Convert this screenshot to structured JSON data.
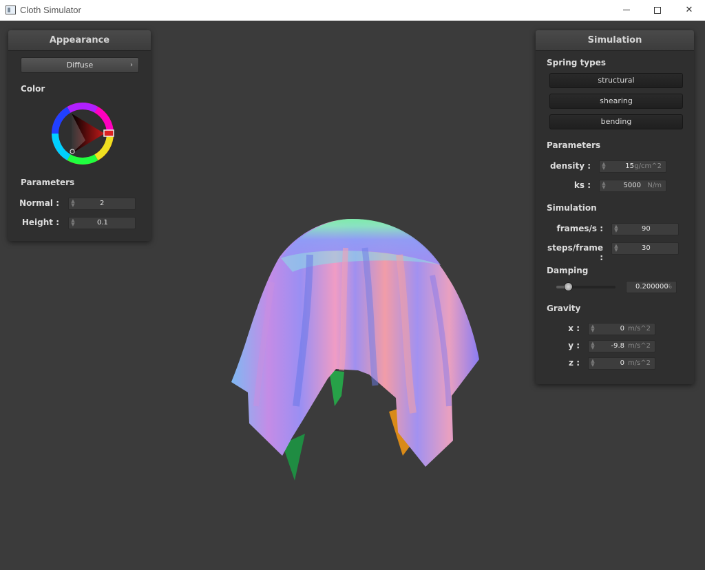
{
  "window": {
    "title": "Cloth Simulator",
    "controls": {
      "minimize": "minimize",
      "maximize": "maximize",
      "close": "✕"
    }
  },
  "appearance": {
    "title": "Appearance",
    "shader_dropdown": {
      "selected": "Diffuse",
      "chevron": "›"
    },
    "color_label": "Color",
    "color_wheel": {
      "selected_color": "#c61a1a"
    },
    "parameters_label": "Parameters",
    "normal": {
      "label": "Normal :",
      "value": "2"
    },
    "height": {
      "label": "Height :",
      "value": "0.1"
    }
  },
  "simulation": {
    "title": "Simulation",
    "spring_types_label": "Spring types",
    "springs": [
      "structural",
      "shearing",
      "bending"
    ],
    "parameters_label": "Parameters",
    "density": {
      "label": "density :",
      "value": "15",
      "unit": "g/cm^2"
    },
    "ks": {
      "label": "ks :",
      "value": "5000",
      "unit": "N/m"
    },
    "sim_label": "Simulation",
    "frames": {
      "label": "frames/s :",
      "value": "90"
    },
    "steps": {
      "label": "steps/frame :",
      "value": "30"
    },
    "damping_label": "Damping",
    "damping": {
      "value": "0.200000",
      "unit": "%",
      "slider_fraction": 0.2
    },
    "gravity_label": "Gravity",
    "gx": {
      "label": "x :",
      "value": "0",
      "unit": "m/s^2"
    },
    "gy": {
      "label": "y :",
      "value": "-9.8",
      "unit": "m/s^2"
    },
    "gz": {
      "label": "z :",
      "value": "0",
      "unit": "m/s^2"
    }
  },
  "colors": {
    "background": "#3b3b3b",
    "panel": "#2f2f2f",
    "titlebar": "#ffffff"
  }
}
